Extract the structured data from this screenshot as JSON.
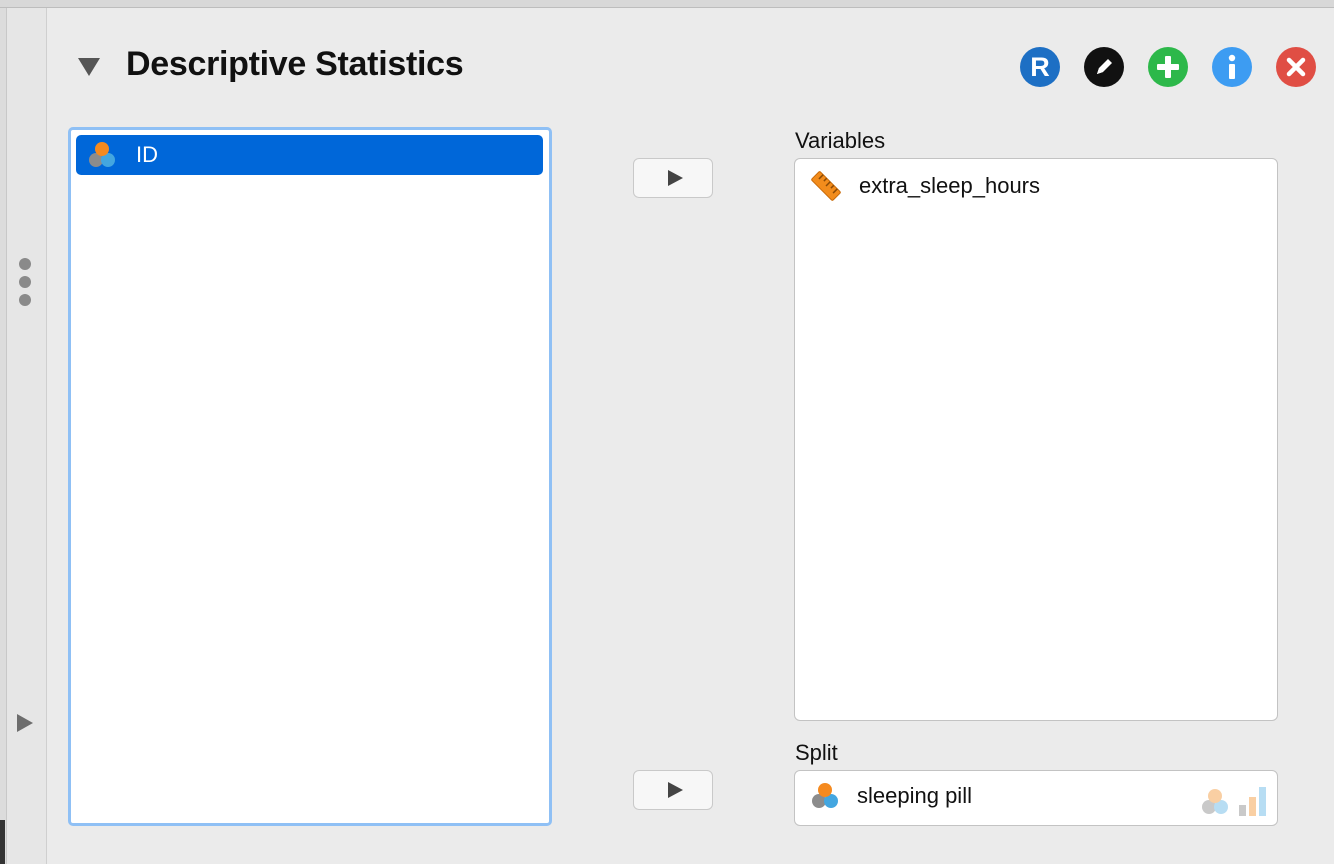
{
  "panel": {
    "title": "Descriptive Statistics",
    "header_buttons": [
      {
        "name": "r-code-button",
        "glyph": "R",
        "color": "#1d6fc4"
      },
      {
        "name": "edit-title-button",
        "glyph": "pencil-icon",
        "color": "#111111"
      },
      {
        "name": "duplicate-analysis-button",
        "glyph": "plus-icon",
        "color": "#2db84a"
      },
      {
        "name": "info-button",
        "glyph": "i",
        "color": "#3d9cf2"
      },
      {
        "name": "remove-analysis-button",
        "glyph": "x-icon",
        "color": "#e04e44"
      }
    ]
  },
  "source_list": {
    "items": [
      {
        "label": "ID",
        "icon": "nominal-variable-icon",
        "selected": true
      }
    ]
  },
  "variables": {
    "label": "Variables",
    "items": [
      {
        "label": "extra_sleep_hours",
        "icon": "scale-variable-icon"
      }
    ]
  },
  "split": {
    "label": "Split",
    "items": [
      {
        "label": "sleeping pill",
        "icon": "nominal-variable-icon"
      }
    ],
    "allowed_types": [
      "nominal-type-icon",
      "ordinal-type-icon"
    ]
  },
  "colors": {
    "selection": "#0067d9",
    "focus_border": "#8fc0f5",
    "nominal_orange": "#f58a1f",
    "nominal_blue": "#43a6e0",
    "nominal_gray": "#8c8c8c"
  }
}
